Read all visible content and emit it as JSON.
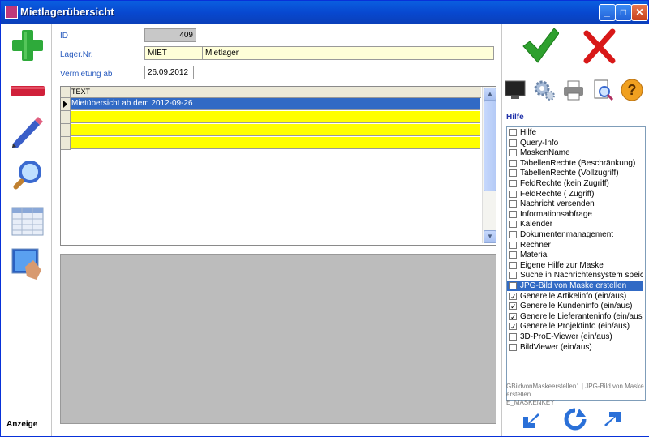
{
  "window": {
    "title": "Mietlagerübersicht",
    "min_icon": "minimize-icon",
    "max_icon": "maximize-icon",
    "close_icon": "close-icon"
  },
  "leftbar": {
    "icons": [
      "add-icon",
      "remove-icon",
      "pencil-icon",
      "magnifier-icon",
      "table-icon",
      "screen-touch-icon"
    ],
    "status_label": "Anzeige"
  },
  "form": {
    "id_label": "ID",
    "id_value": "409",
    "lager_label": "Lager.Nr.",
    "lager_code": "MIET",
    "lager_name": "Mietlager",
    "vermietung_label": "Vermietung ab",
    "vermietung_value": "26.09.2012"
  },
  "grid": {
    "column_header": "TEXT",
    "rows": [
      "Mietübersicht ab dem 2012-09-26",
      "",
      "",
      ""
    ],
    "colors": {
      "selected": "#316ac5",
      "empty": "#ffff00"
    }
  },
  "toolbar_right": {
    "icons": [
      "ok-check-icon",
      "cancel-x-icon",
      "monitor-icon",
      "settings-gears-icon",
      "printer-icon",
      "search-document-icon",
      "help-question-icon"
    ]
  },
  "help": {
    "label": "Hilfe",
    "items": [
      {
        "text": "Hilfe",
        "checked": false
      },
      {
        "text": "Query-Info",
        "checked": false
      },
      {
        "text": "MaskenName",
        "checked": false
      },
      {
        "text": "TabellenRechte (Beschränkung)",
        "checked": false
      },
      {
        "text": "TabellenRechte (Vollzugriff)",
        "checked": false
      },
      {
        "text": "FeldRechte (kein Zugriff)",
        "checked": false
      },
      {
        "text": "FeldRechte ( Zugriff)",
        "checked": false
      },
      {
        "text": "Nachricht versenden",
        "checked": false
      },
      {
        "text": "Informationsabfrage",
        "checked": false
      },
      {
        "text": "Kalender",
        "checked": false
      },
      {
        "text": "Dokumentenmanagement",
        "checked": false
      },
      {
        "text": "Rechner",
        "checked": false
      },
      {
        "text": "Material",
        "checked": false
      },
      {
        "text": "Eigene Hilfe zur Maske",
        "checked": false
      },
      {
        "text": "Suche in Nachrichtensystem speich",
        "checked": false
      },
      {
        "text": "JPG-Bild von Maske erstellen",
        "checked": false,
        "selected": true
      },
      {
        "text": "Generelle Artikelinfo (ein/aus)",
        "checked": true
      },
      {
        "text": "Generelle Kundeninfo (ein/aus)",
        "checked": true
      },
      {
        "text": "Generelle Lieferanteninfo (ein/aus)",
        "checked": true
      },
      {
        "text": "Generelle Projektinfo (ein/aus)",
        "checked": true
      },
      {
        "text": "3D-ProE-Viewer (ein/aus)",
        "checked": false
      },
      {
        "text": "BildViewer (ein/aus)",
        "checked": false
      }
    ],
    "info_line1": "GBildvonMaskeerstellen1 | JPG-Bild von Maske erstellen",
    "info_line2": "E_MASKENKEY"
  },
  "nav": {
    "icons": [
      "arrow-back-icon",
      "refresh-icon",
      "arrow-forward-icon"
    ]
  }
}
